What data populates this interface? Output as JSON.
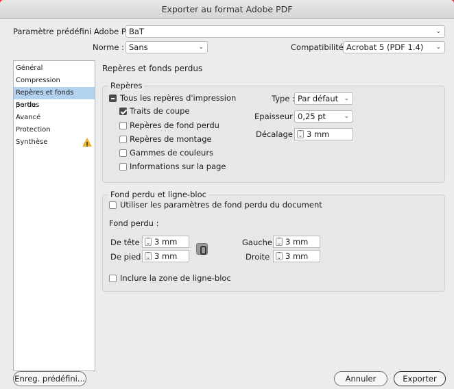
{
  "window": {
    "title": "Exporter au format Adobe PDF"
  },
  "preset": {
    "label": "Paramètre prédéfini Adobe PDF :",
    "value": "BaT"
  },
  "norme": {
    "label": "Norme :",
    "value": "Sans"
  },
  "compat": {
    "label": "Compatibilité :",
    "value": "Acrobat 5 (PDF 1.4)"
  },
  "sidebar": {
    "items": [
      {
        "label": "Général"
      },
      {
        "label": "Compression"
      },
      {
        "label": "Repères et fonds perdus"
      },
      {
        "label": "Sortie"
      },
      {
        "label": "Avancé"
      },
      {
        "label": "Protection"
      },
      {
        "label": "Synthèse"
      }
    ],
    "selected": "Repères et fonds perdus",
    "warning_icon": "!"
  },
  "section": {
    "title": "Repères et fonds perdus"
  },
  "reperes": {
    "title": "Repères",
    "all_label": "Tous les repères d'impression",
    "items": [
      {
        "label": "Traits de coupe",
        "checked": true
      },
      {
        "label": "Repères de fond perdu",
        "checked": false
      },
      {
        "label": "Repères de montage",
        "checked": false
      },
      {
        "label": "Gammes de couleurs",
        "checked": false
      },
      {
        "label": "Informations sur la page",
        "checked": false
      }
    ],
    "type_label": "Type :",
    "type_value": "Par défaut",
    "epaisseur_label": "Epaisseur :",
    "epaisseur_value": "0,25 pt",
    "decalage_label": "Décalage :",
    "decalage_value": "3 mm"
  },
  "fond": {
    "title": "Fond perdu et ligne-bloc",
    "use_doc_label": "Utiliser les paramètres de fond perdu du document",
    "fond_label": "Fond perdu :",
    "tete_label": "De tête :",
    "tete_value": "3 mm",
    "pied_label": "De pied :",
    "pied_value": "3 mm",
    "gauche_label": "Gauche :",
    "gauche_value": "3 mm",
    "droite_label": "Droite :",
    "droite_value": "3 mm",
    "slug_label": "Inclure la zone de ligne-bloc"
  },
  "footer": {
    "save_preset": "Enreg. prédéfini...",
    "cancel": "Annuler",
    "export": "Exporter"
  }
}
